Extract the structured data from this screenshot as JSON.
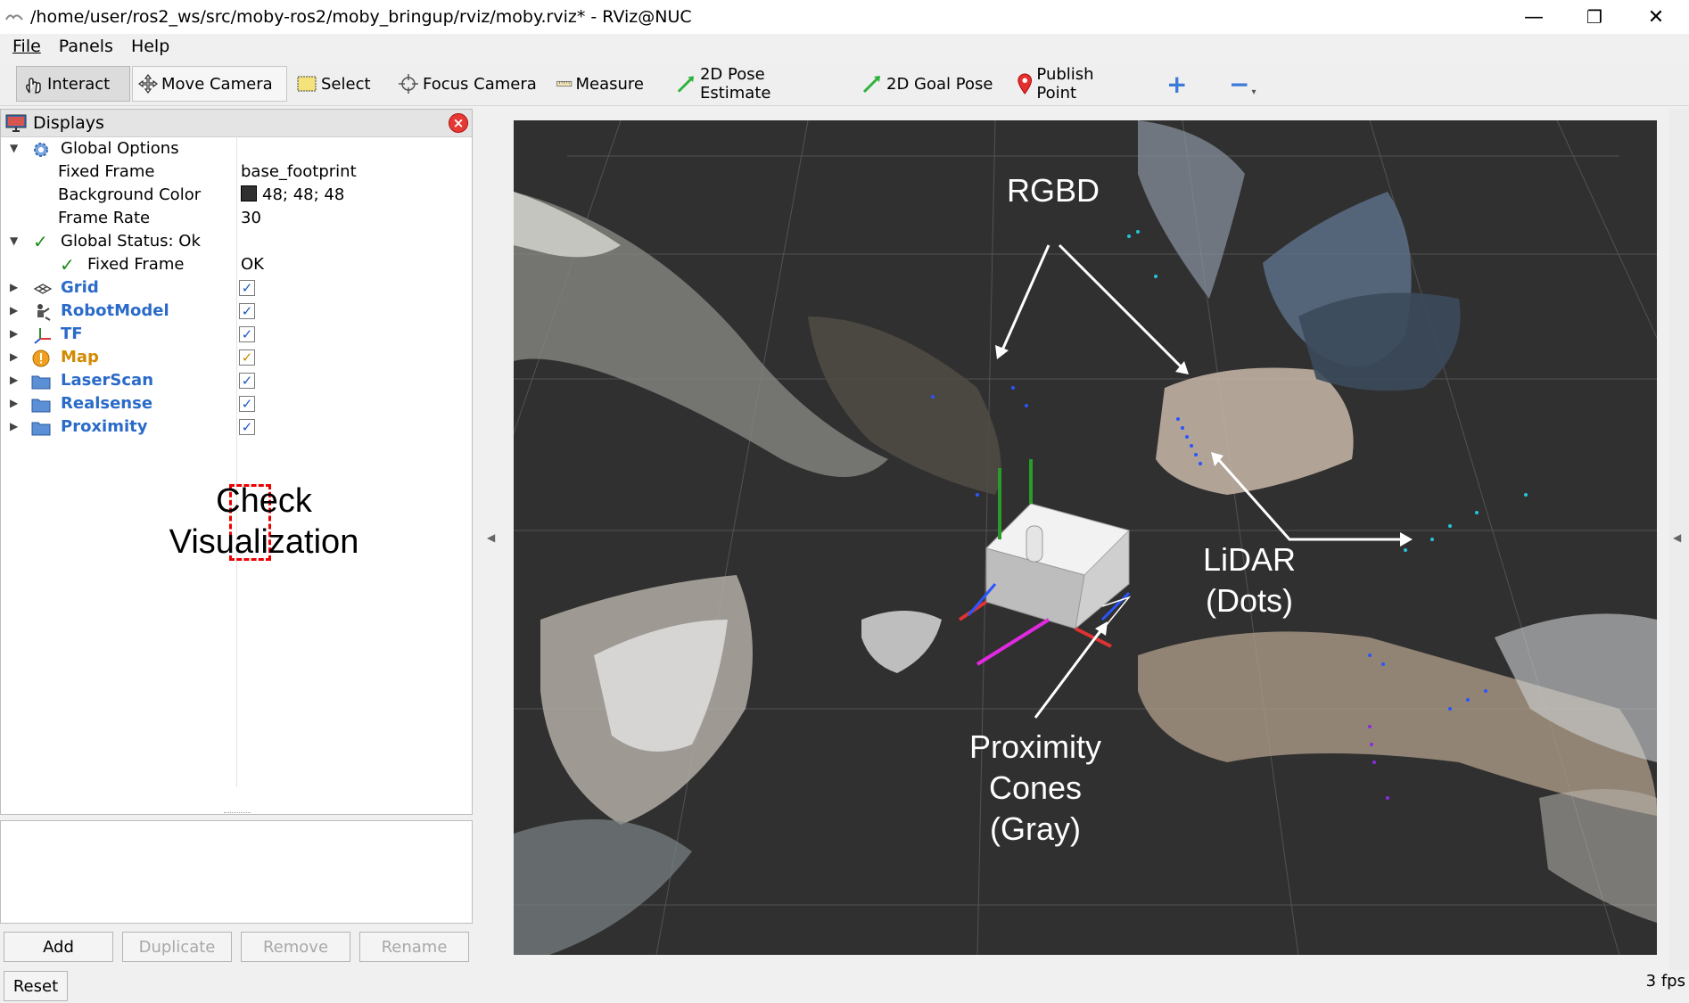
{
  "window": {
    "title": "/home/user/ros2_ws/src/moby-ros2/moby_bringup/rviz/moby.rviz* - RViz@NUC",
    "minimize": "—",
    "maximize": "❐",
    "close": "✕"
  },
  "menu": [
    "File",
    "Panels",
    "Help"
  ],
  "toolbar": {
    "interact": "Interact",
    "move_camera": "Move Camera",
    "select": "Select",
    "focus_camera": "Focus Camera",
    "measure": "Measure",
    "pose_estimate": "2D Pose Estimate",
    "goal_pose": "2D Goal Pose",
    "publish_point": "Publish Point",
    "add_tool": "+",
    "remove_tool": "−"
  },
  "displays": {
    "title": "Displays",
    "global_options": "Global Options",
    "fixed_frame_label": "Fixed Frame",
    "fixed_frame_value": "base_footprint",
    "bg_color_label": "Background Color",
    "bg_color_value": "48; 48; 48",
    "bg_color_swatch": "#303030",
    "frame_rate_label": "Frame Rate",
    "frame_rate_value": "30",
    "global_status": "Global Status: Ok",
    "status_fixed_frame": "Fixed Frame",
    "status_fixed_frame_value": "OK",
    "items": [
      {
        "name": "Grid",
        "checked": true
      },
      {
        "name": "RobotModel",
        "checked": true
      },
      {
        "name": "TF",
        "checked": true
      },
      {
        "name": "Map",
        "checked": true
      },
      {
        "name": "LaserScan",
        "checked": true
      },
      {
        "name": "Realsense",
        "checked": true
      },
      {
        "name": "Proximity",
        "checked": true
      }
    ]
  },
  "annotations": {
    "check_line1": "Check",
    "check_line2": "Visualization",
    "rgbd": "RGBD",
    "lidar_line1": "LiDAR",
    "lidar_line2": "(Dots)",
    "prox_line1": "Proximity",
    "prox_line2": "Cones",
    "prox_line3": "(Gray)"
  },
  "buttons": {
    "add": "Add",
    "duplicate": "Duplicate",
    "remove": "Remove",
    "rename": "Rename",
    "reset": "Reset"
  },
  "status": {
    "fps": "3 fps"
  },
  "colors": {
    "viewport_bg": "#303030",
    "accent_blue": "#2a6ac8",
    "warn_orange": "#d28a00",
    "annotation_red": "#e00000"
  }
}
